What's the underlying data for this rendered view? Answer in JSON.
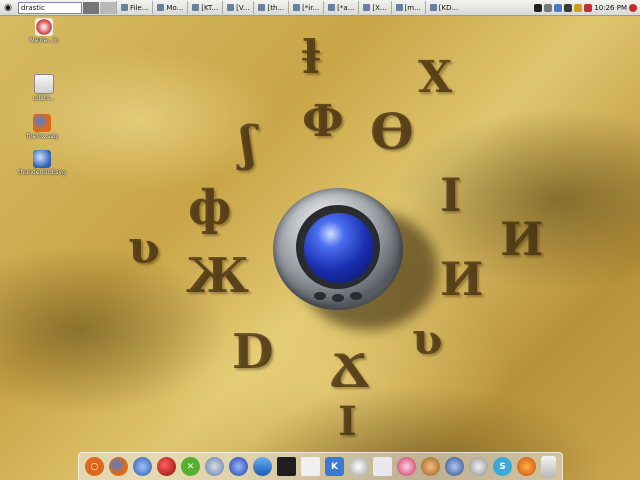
{
  "top_panel": {
    "search_text": "drastic",
    "tasks": [
      {
        "label": "File..."
      },
      {
        "label": "Mo..."
      },
      {
        "label": "[KT..."
      },
      {
        "label": "[V..."
      },
      {
        "label": "[th..."
      },
      {
        "label": "[*ir..."
      },
      {
        "label": "[*a..."
      },
      {
        "label": "[X..."
      },
      {
        "label": "[m..."
      },
      {
        "label": "[KD..."
      }
    ],
    "clock": "10:26 PM"
  },
  "desktop_icons": [
    {
      "label": "MeTra...io"
    },
    {
      "label": "Ld1(s..."
    },
    {
      "label": "firefox.svg"
    },
    {
      "label": "thunderbird.svg"
    }
  ],
  "dock_icons": [
    "ubuntu-icon",
    "firefox-icon",
    "globe-icon",
    "red-ball-icon",
    "x-icon",
    "network-icon",
    "kde-icon",
    "water-icon",
    "terminal-icon",
    "paper-icon",
    "k-icon",
    "eagle-icon",
    "document-icon",
    "media-icon",
    "dog-icon",
    "antenna-icon",
    "disk-icon",
    "skype-icon",
    "tomato-icon",
    "trash-icon"
  ],
  "colors": {
    "accent_blue": "#1a2fb0",
    "sand": "#d7bc63"
  }
}
